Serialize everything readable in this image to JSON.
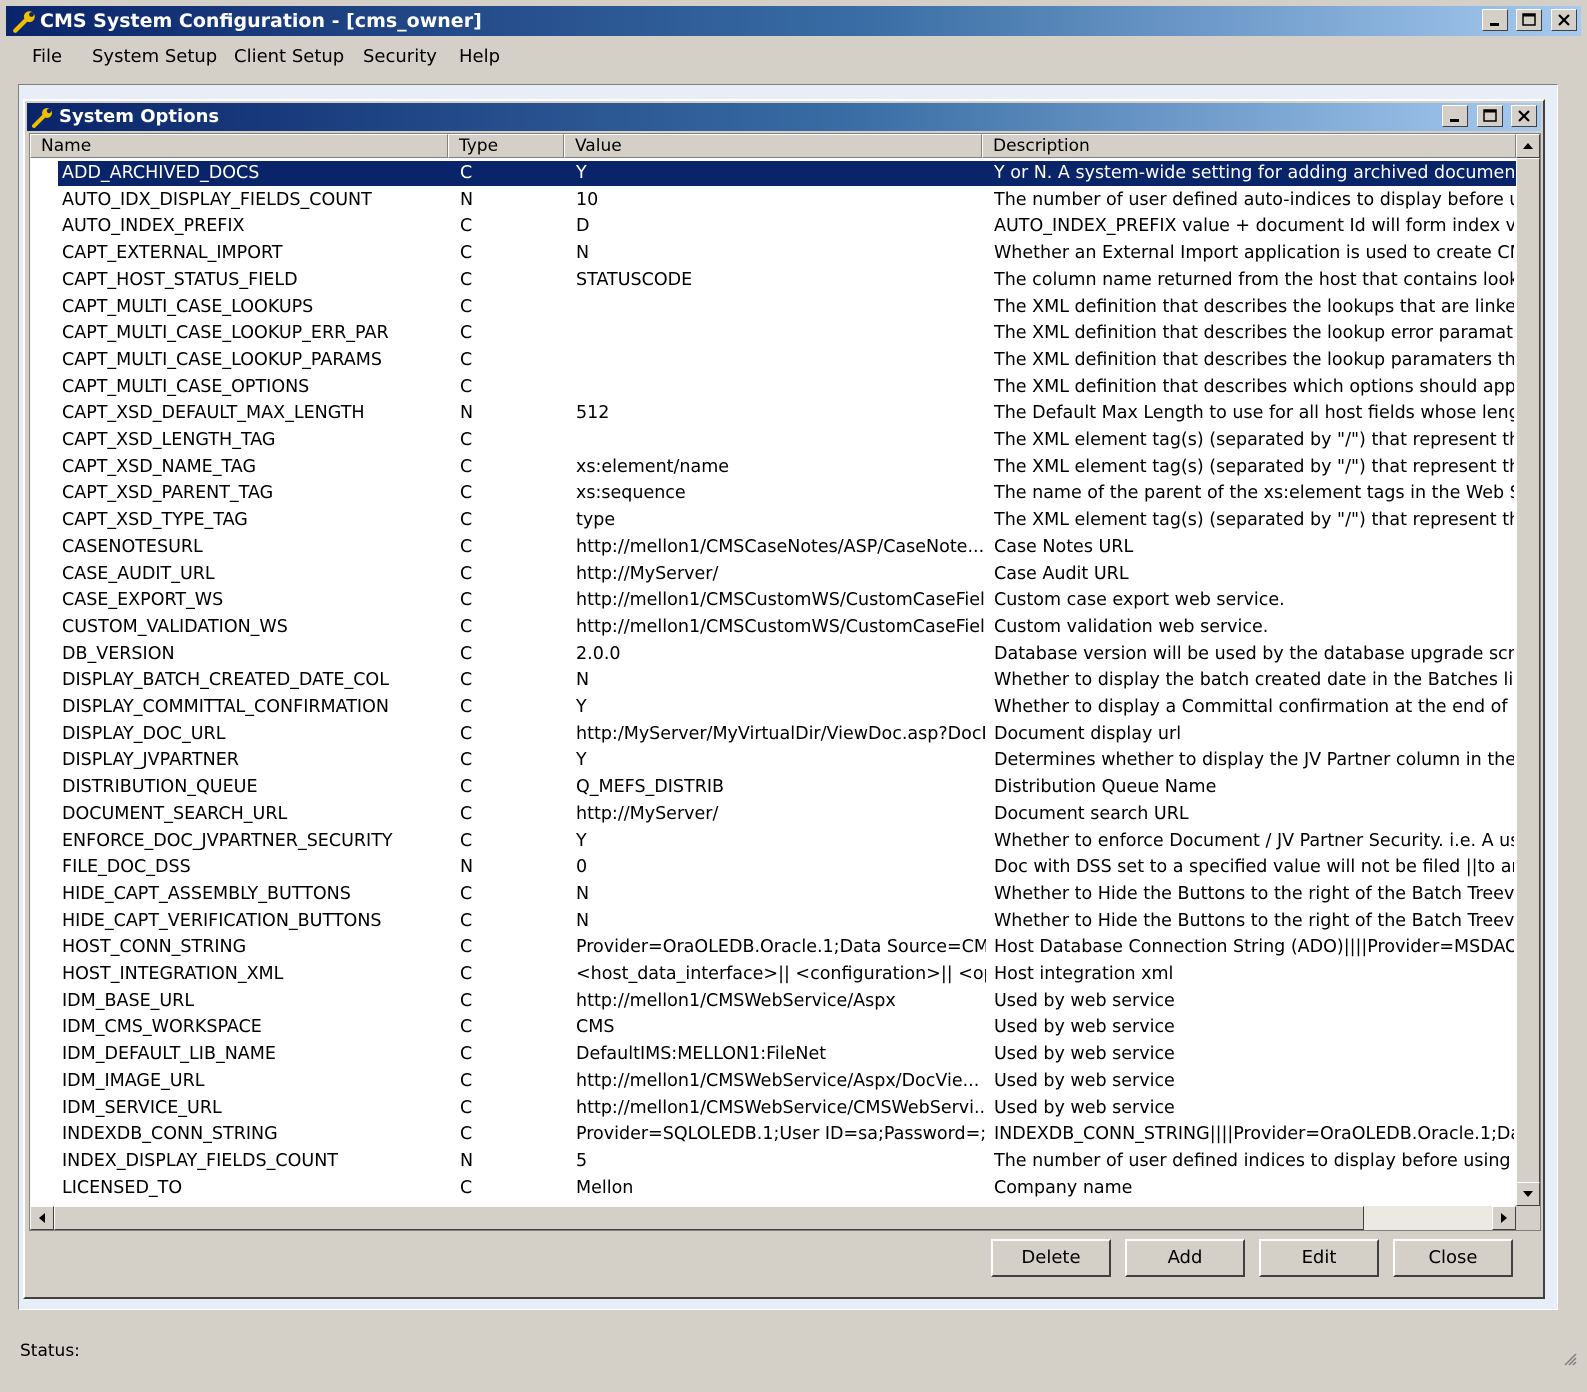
{
  "window": {
    "title": "CMS System Configuration - [cms_owner]"
  },
  "menu": {
    "items": [
      "File",
      "System Setup",
      "Client Setup",
      "Security",
      "Help"
    ]
  },
  "child_window": {
    "title": "System Options"
  },
  "table": {
    "columns": [
      "Name",
      "Type",
      "Value",
      "Description"
    ],
    "selected_index": 0,
    "rows": [
      {
        "name": "ADD_ARCHIVED_DOCS",
        "type": "C",
        "value": "Y",
        "description": "Y or N. A system-wide setting for adding archived documents to a"
      },
      {
        "name": "AUTO_IDX_DISPLAY_FIELDS_COUNT",
        "type": "N",
        "value": "10",
        "description": "The number of user defined auto-indices to display before using sc"
      },
      {
        "name": "AUTO_INDEX_PREFIX",
        "type": "C",
        "value": "D",
        "description": "AUTO_INDEX_PREFIX value + document Id will form index value"
      },
      {
        "name": "CAPT_EXTERNAL_IMPORT",
        "type": "C",
        "value": "N",
        "description": "Whether an External Import application is used to create CMS batc"
      },
      {
        "name": "CAPT_HOST_STATUS_FIELD",
        "type": "C",
        "value": "STATUSCODE",
        "description": "The column name returned from the host that contains lookup stat"
      },
      {
        "name": "CAPT_MULTI_CASE_LOOKUPS",
        "type": "C",
        "value": "",
        "description": "The XML definition that describes the lookups that are linked to th"
      },
      {
        "name": "CAPT_MULTI_CASE_LOOKUP_ERR_PAR",
        "type": "C",
        "value": "",
        "description": "The XML definition that describes the lookup error paramaters that"
      },
      {
        "name": "CAPT_MULTI_CASE_LOOKUP_PARAMS",
        "type": "C",
        "value": "",
        "description": "The XML definition that describes the lookup paramaters that are l"
      },
      {
        "name": "CAPT_MULTI_CASE_OPTIONS",
        "type": "C",
        "value": "",
        "description": "The XML definition that describes which options should appear in"
      },
      {
        "name": "CAPT_XSD_DEFAULT_MAX_LENGTH",
        "type": "N",
        "value": "512",
        "description": "The Default Max Length to use for all host fields whose length car"
      },
      {
        "name": "CAPT_XSD_LENGTH_TAG",
        "type": "C",
        "value": "",
        "description": "The XML element tag(s) (separated by \"/\")  that represent the chil"
      },
      {
        "name": "CAPT_XSD_NAME_TAG",
        "type": "C",
        "value": "xs:element/name",
        "description": "The XML element tag(s) (separated by \"/\")  that represent the chil"
      },
      {
        "name": "CAPT_XSD_PARENT_TAG",
        "type": "C",
        "value": "xs:sequence",
        "description": "The name of the parent of the xs:element tags in the Web Service"
      },
      {
        "name": "CAPT_XSD_TYPE_TAG",
        "type": "C",
        "value": "type",
        "description": "The XML element tag(s) (separated by \"/\")  that represent the chil"
      },
      {
        "name": "CASENOTESURL",
        "type": "C",
        "value": "http://mellon1/CMSCaseNotes/ASP/CaseNote...",
        "description": "Case Notes URL"
      },
      {
        "name": "CASE_AUDIT_URL",
        "type": "C",
        "value": "http://MyServer/",
        "description": "Case Audit URL"
      },
      {
        "name": "CASE_EXPORT_WS",
        "type": "C",
        "value": "http://mellon1/CMSCustomWS/CustomCaseFiel...",
        "description": "Custom case export web service."
      },
      {
        "name": "CUSTOM_VALIDATION_WS",
        "type": "C",
        "value": "http://mellon1/CMSCustomWS/CustomCaseFiel...",
        "description": "Custom validation web service."
      },
      {
        "name": "DB_VERSION",
        "type": "C",
        "value": "2.0.0",
        "description": "Database version will be used by the database upgrade scripts."
      },
      {
        "name": "DISPLAY_BATCH_CREATED_DATE_COL",
        "type": "C",
        "value": "N",
        "description": "Whether to display the batch created date in the Batches list view"
      },
      {
        "name": "DISPLAY_COMMITTAL_CONFIRMATION",
        "type": "C",
        "value": "Y",
        "description": "Whether to display a Committal confirmation at the end of indexing"
      },
      {
        "name": "DISPLAY_DOC_URL",
        "type": "C",
        "value": "http:/MyServer/MyVirtualDir/ViewDoc.asp?DocI...",
        "description": "Document display url"
      },
      {
        "name": "DISPLAY_JVPARTNER",
        "type": "C",
        "value": "Y",
        "description": "Determines whether to display the JV Partner column in the Captur"
      },
      {
        "name": "DISTRIBUTION_QUEUE",
        "type": "C",
        "value": "Q_MEFS_DISTRIB",
        "description": "Distribution Queue Name"
      },
      {
        "name": "DOCUMENT_SEARCH_URL",
        "type": "C",
        "value": "http://MyServer/",
        "description": "Document search URL"
      },
      {
        "name": "ENFORCE_DOC_JVPARTNER_SECURITY",
        "type": "C",
        "value": "Y",
        "description": "Whether to enforce Document / JV Partner Security. i.e. A user ca"
      },
      {
        "name": "FILE_DOC_DSS",
        "type": "N",
        "value": "0",
        "description": "Doc with DSS set to a specified value will not be filed ||to an existi"
      },
      {
        "name": "HIDE_CAPT_ASSEMBLY_BUTTONS",
        "type": "C",
        "value": "N",
        "description": "Whether to Hide the Buttons to the right of the Batch Treeview||Va"
      },
      {
        "name": "HIDE_CAPT_VERIFICATION_BUTTONS",
        "type": "C",
        "value": "N",
        "description": "Whether to Hide the Buttons to the right of the Batch Treeview||Va"
      },
      {
        "name": "HOST_CONN_STRING",
        "type": "C",
        "value": "Provider=OraOLEDB.Oracle.1;Data Source=CM...",
        "description": "Host Database Connection String (ADO)||||Provider=MSDAORA.1"
      },
      {
        "name": "HOST_INTEGRATION_XML",
        "type": "C",
        "value": "<host_data_interface>||  <configuration>||   <op...",
        "description": "Host integration xml"
      },
      {
        "name": "IDM_BASE_URL",
        "type": "C",
        "value": "http://mellon1/CMSWebService/Aspx",
        "description": "Used by web service"
      },
      {
        "name": "IDM_CMS_WORKSPACE",
        "type": "C",
        "value": "CMS",
        "description": "Used by web service"
      },
      {
        "name": "IDM_DEFAULT_LIB_NAME",
        "type": "C",
        "value": "DefaultIMS:MELLON1:FileNet",
        "description": "Used by web service"
      },
      {
        "name": "IDM_IMAGE_URL",
        "type": "C",
        "value": "http://mellon1/CMSWebService/Aspx/DocVie...",
        "description": "Used by web service"
      },
      {
        "name": "IDM_SERVICE_URL",
        "type": "C",
        "value": "http://mellon1/CMSWebService/CMSWebServi...",
        "description": "Used by web service"
      },
      {
        "name": "INDEXDB_CONN_STRING",
        "type": "C",
        "value": "Provider=SQLOLEDB.1;User ID=sa;Password=;I...",
        "description": "INDEXDB_CONN_STRING||||Provider=OraOLEDB.Oracle.1;Data"
      },
      {
        "name": "INDEX_DISPLAY_FIELDS_COUNT",
        "type": "N",
        "value": "5",
        "description": "The number of user defined indices to display before using scroll b"
      },
      {
        "name": "LICENSED_TO",
        "type": "C",
        "value": "Mellon",
        "description": "Company name"
      }
    ]
  },
  "buttons": {
    "delete": "Delete",
    "add": "Add",
    "edit": "Edit",
    "close": "Close"
  },
  "status": {
    "label": "Status:"
  },
  "icons": {
    "app": "wrench-icon",
    "child": "wrench-icon"
  },
  "colors": {
    "title_start": "#0a246a",
    "title_end": "#a6caf0",
    "selection": "#0a246a",
    "face": "#d4d0c8"
  }
}
